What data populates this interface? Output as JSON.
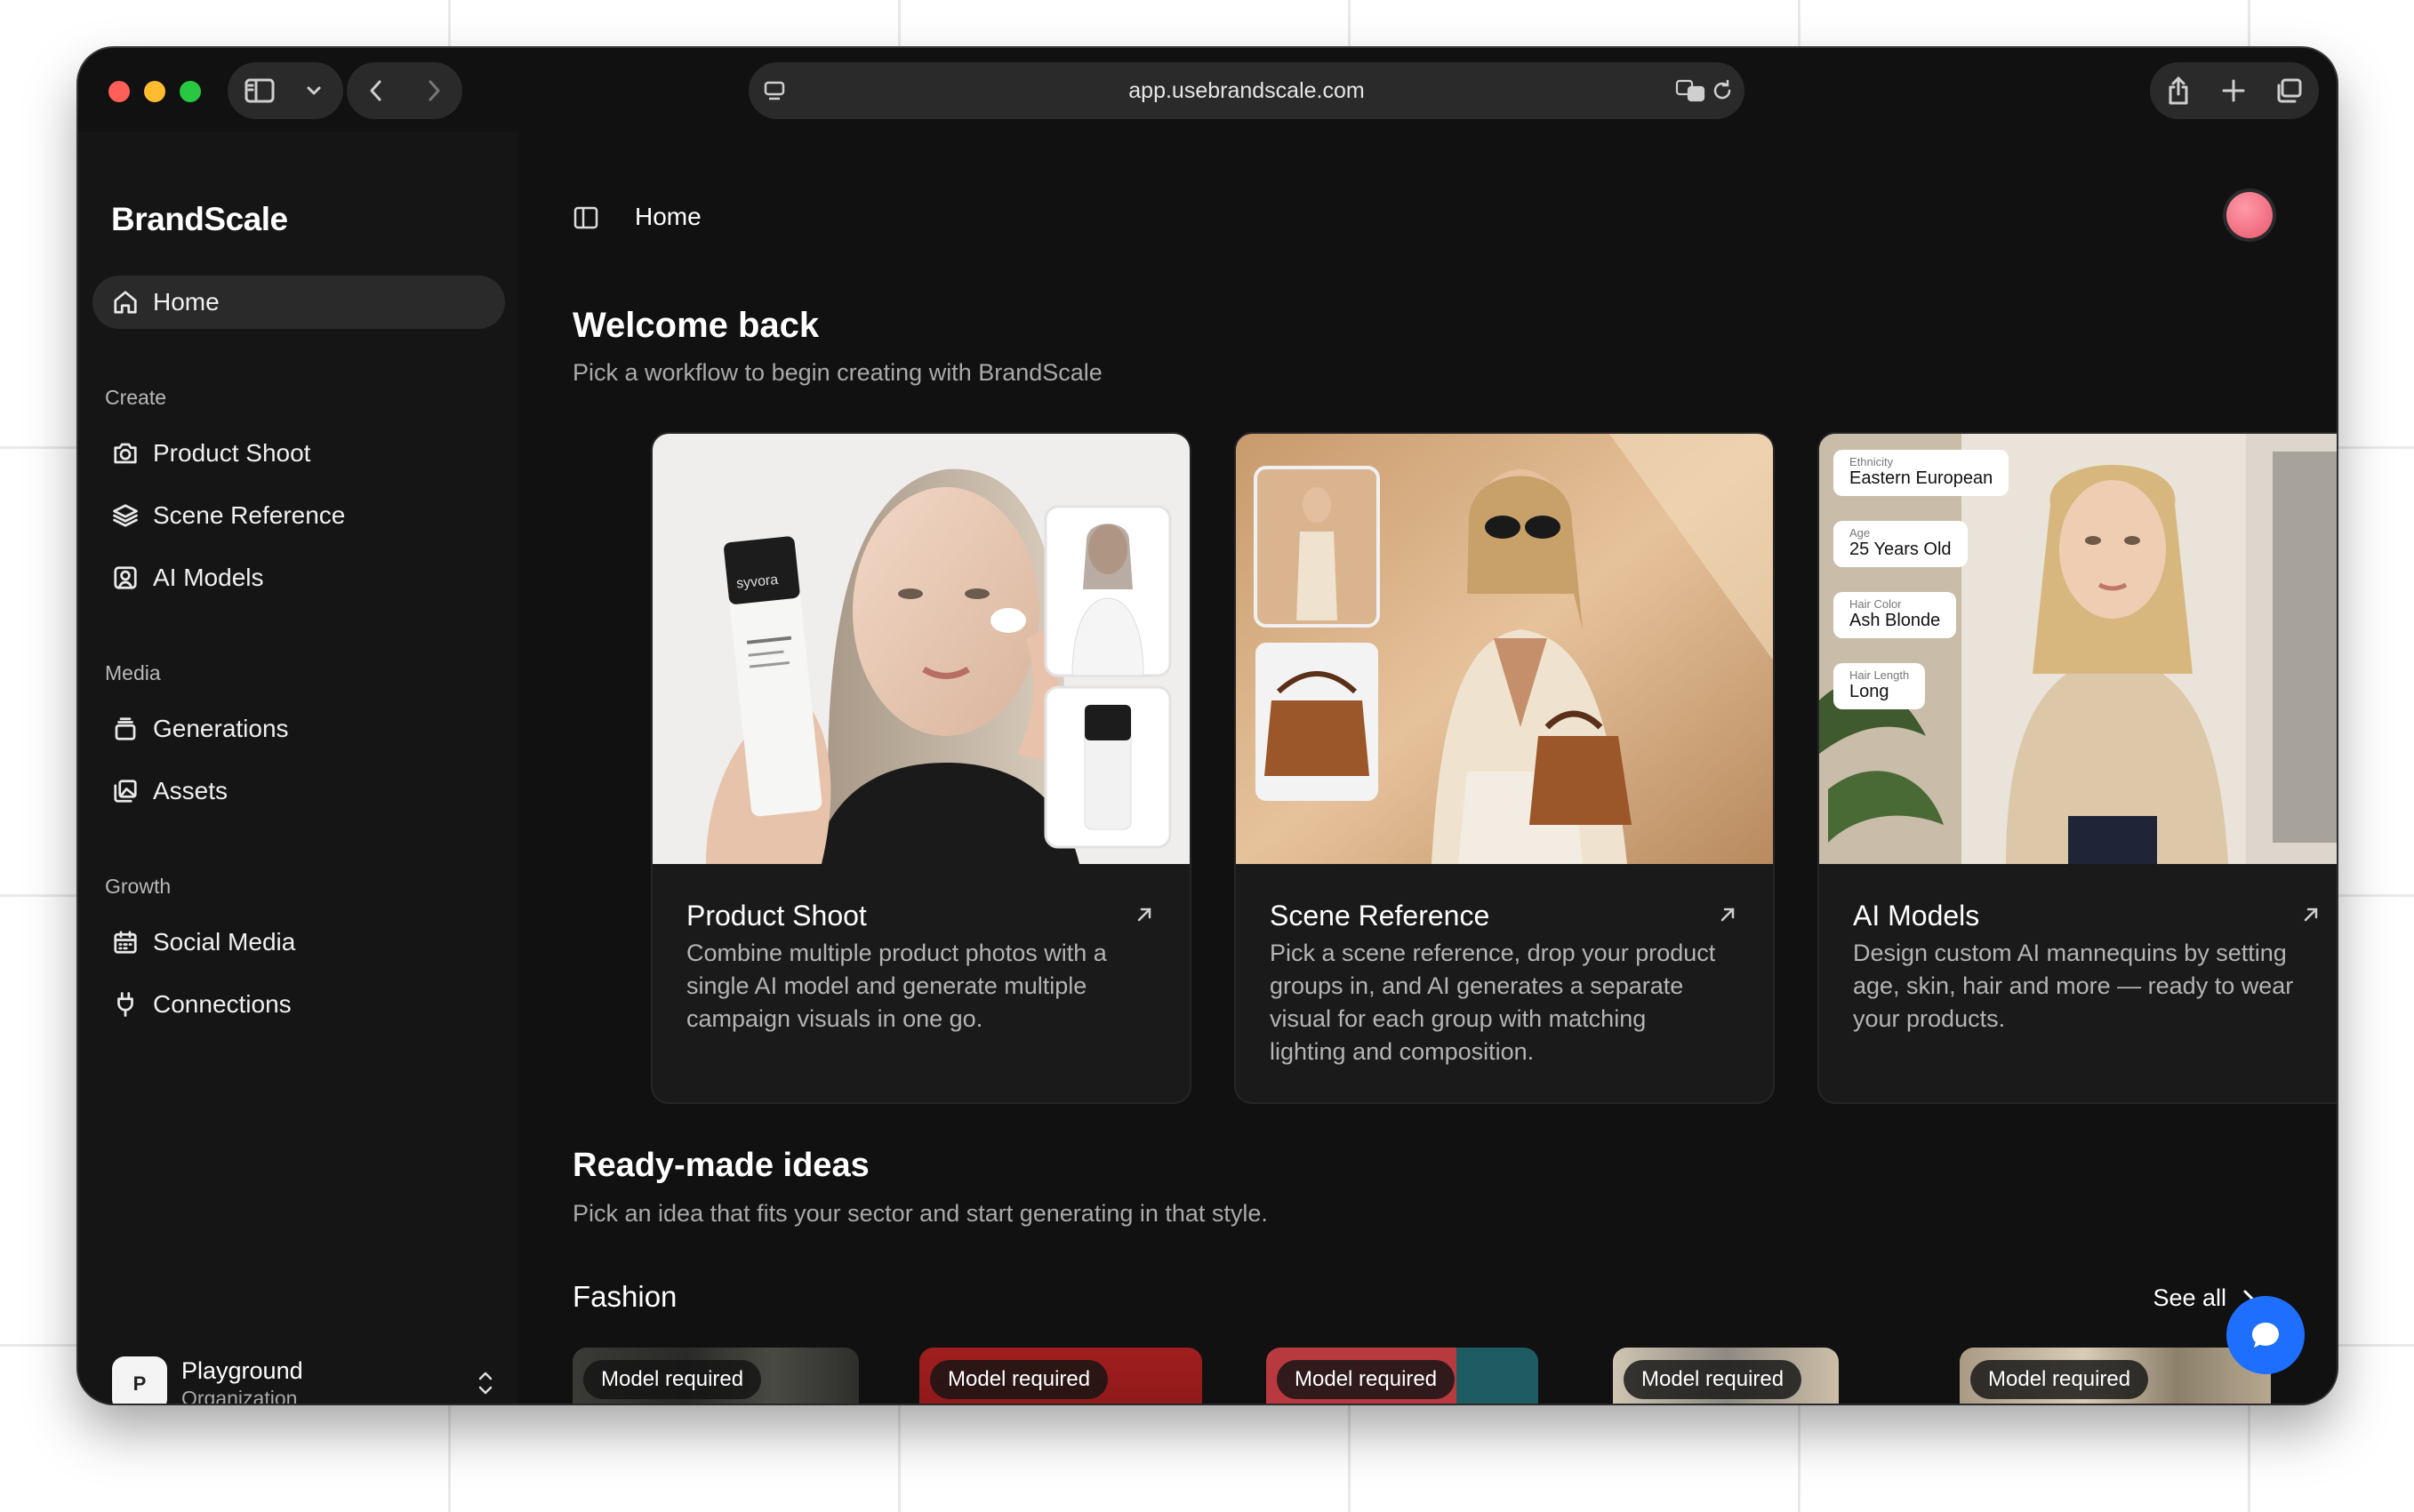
{
  "browser": {
    "url": "app.usebrandscale.com"
  },
  "sidebar": {
    "brand": "BrandScale",
    "home_label": "Home",
    "sections": [
      {
        "label": "Create",
        "items": [
          "Product Shoot",
          "Scene Reference",
          "AI Models"
        ]
      },
      {
        "label": "Media",
        "items": [
          "Generations",
          "Assets"
        ]
      },
      {
        "label": "Growth",
        "items": [
          "Social Media",
          "Connections"
        ]
      }
    ],
    "org": {
      "initial": "P",
      "name": "Playground",
      "type": "Organization"
    }
  },
  "header": {
    "breadcrumb": "Home"
  },
  "welcome": {
    "title": "Welcome back",
    "subtitle": "Pick a workflow to begin creating with BrandScale"
  },
  "workflows": [
    {
      "title": "Product Shoot",
      "description": "Combine multiple product photos with a single AI model and generate multiple campaign visuals in one go."
    },
    {
      "title": "Scene Reference",
      "description": "Pick a scene reference, drop your product groups in, and AI generates a separate visual for each group with matching lighting and composition."
    },
    {
      "title": "AI Models",
      "description": "Design custom AI mannequins by setting age, skin, hair and more — ready to wear your products."
    }
  ],
  "ai_model_chips": [
    {
      "label": "Ethnicity",
      "value": "Eastern European"
    },
    {
      "label": "Age",
      "value": "25 Years Old"
    },
    {
      "label": "Hair Color",
      "value": "Ash Blonde"
    },
    {
      "label": "Hair Length",
      "value": "Long"
    }
  ],
  "product_brand_text": "syvora",
  "ideas": {
    "title": "Ready-made ideas",
    "subtitle": "Pick an idea that fits your sector and start generating in that style.",
    "category": "Fashion",
    "see_all": "See all",
    "items": [
      {
        "badge": "Model required"
      },
      {
        "badge": "Model required"
      },
      {
        "badge": "Model required"
      },
      {
        "badge": "Model required"
      },
      {
        "badge": "Model required"
      }
    ]
  },
  "colors": {
    "window_bg": "#111111",
    "sidebar_bg": "#151515",
    "active_item_bg": "#2a2a2a",
    "card_bg": "#1a1a1a",
    "chat_button": "#1f6fff",
    "traffic_red": "#ff5f57",
    "traffic_yellow": "#febc2e",
    "traffic_green": "#28c840"
  }
}
